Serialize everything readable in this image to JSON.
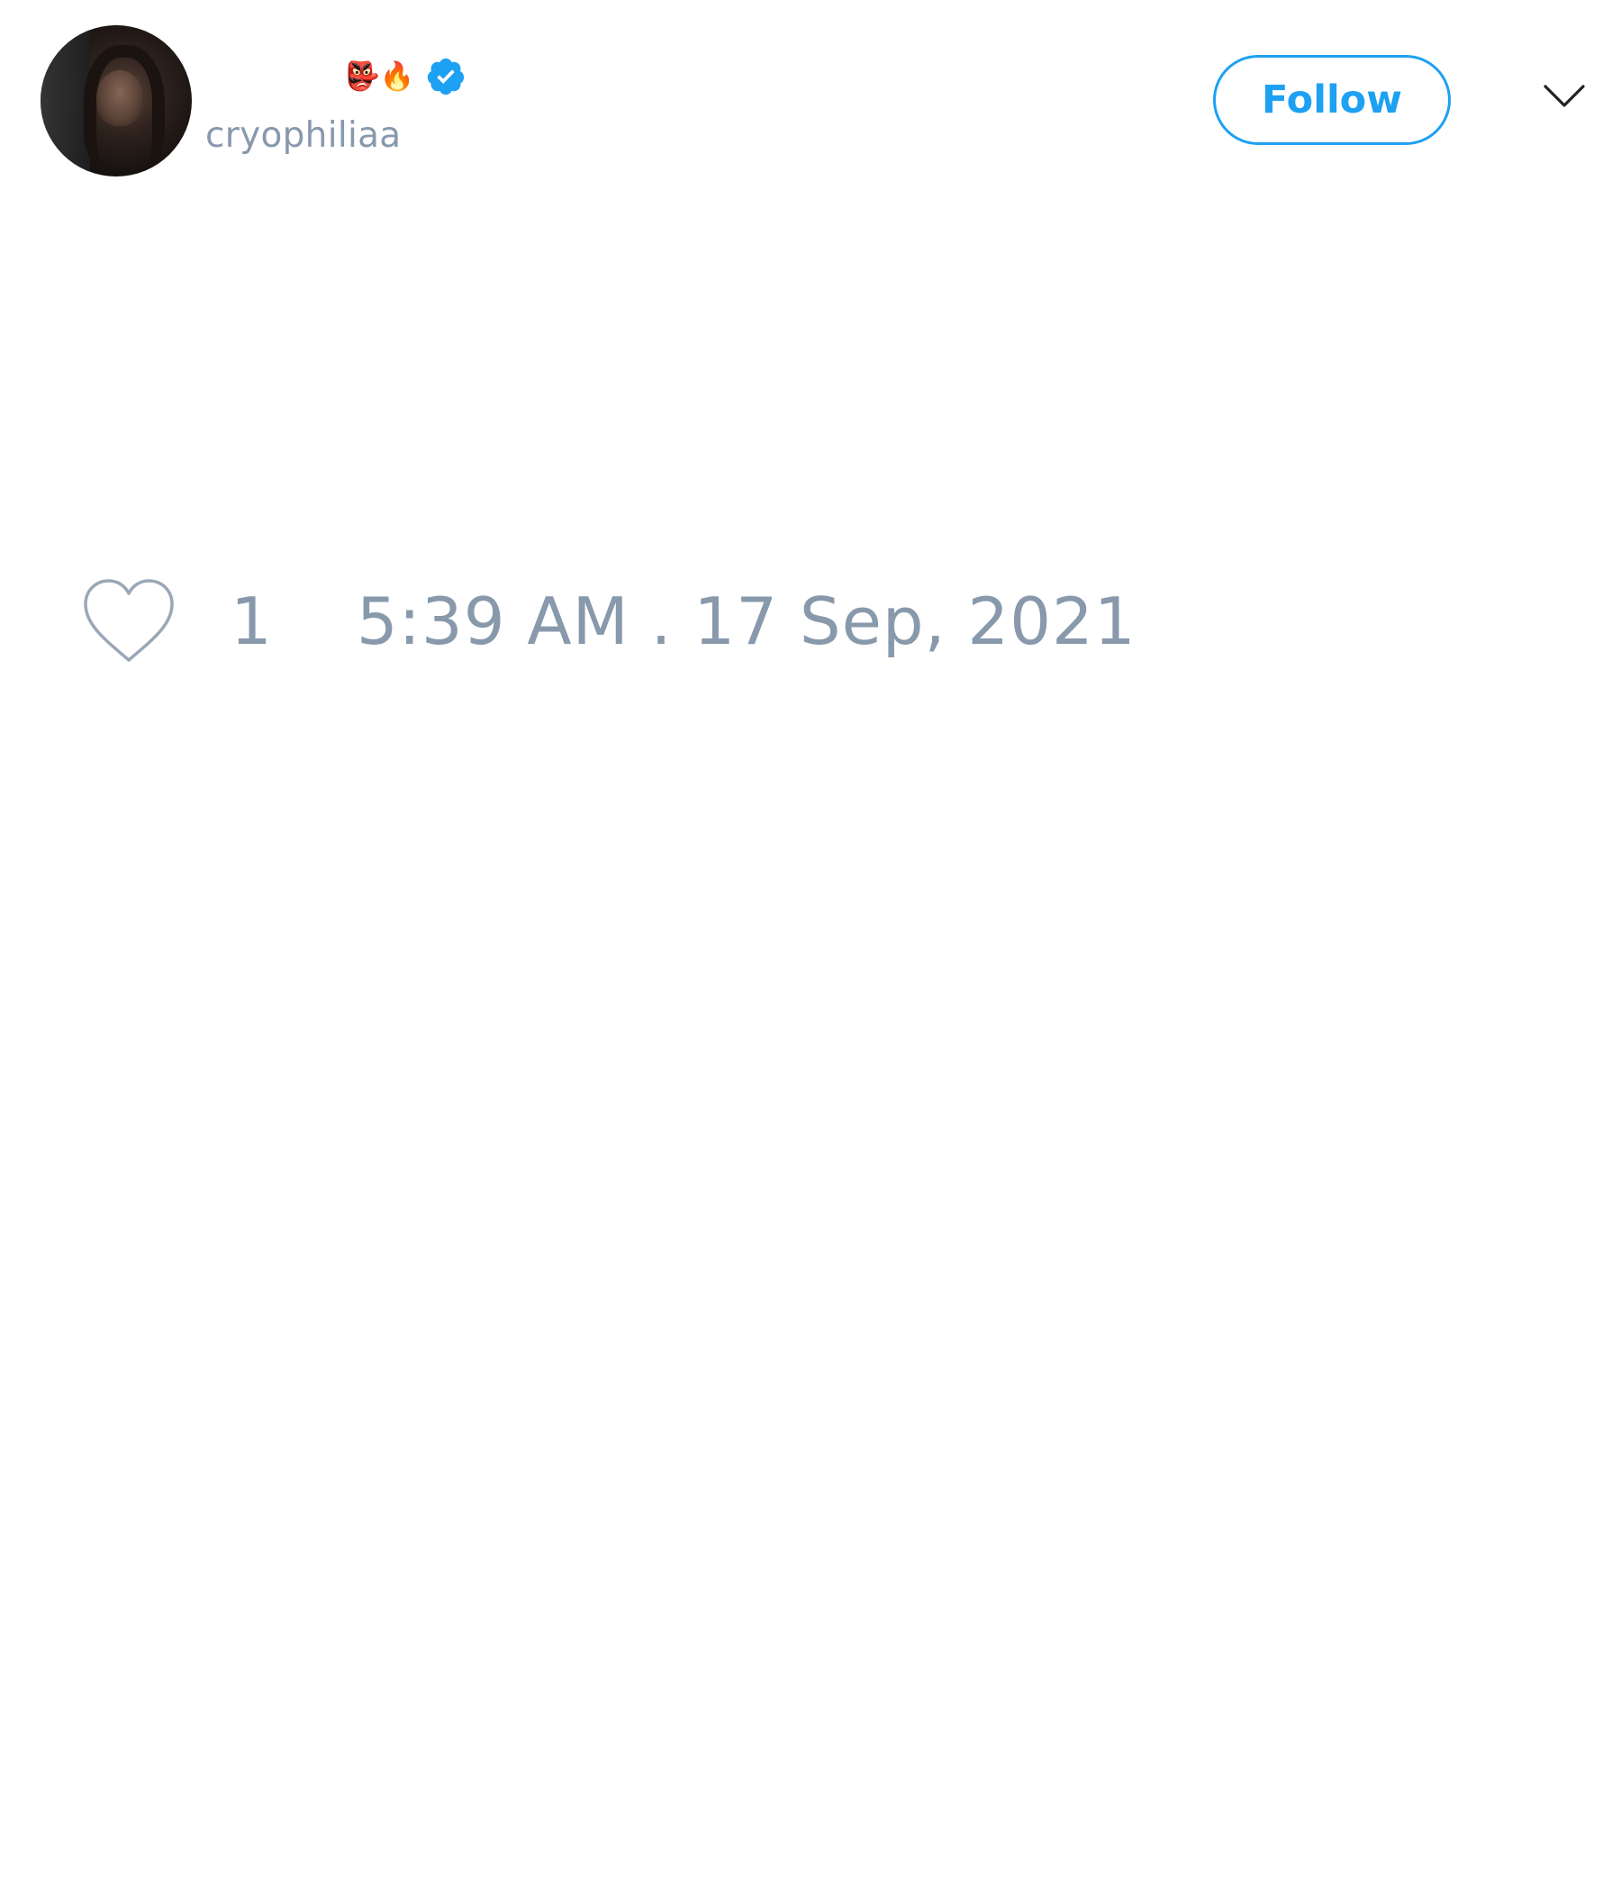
{
  "tweet": {
    "author": {
      "name_emojis": "👺🔥",
      "verified": true,
      "handle": "cryophiliaa"
    },
    "follow_label": "Follow",
    "like_count": "1",
    "timestamp": "5:39 AM . 17 Sep, 2021"
  },
  "colors": {
    "accent": "#1da1f2",
    "muted": "#8899ac",
    "background": "#ffffff"
  },
  "icons": {
    "avatar": "avatar",
    "verified": "verified-badge-icon",
    "menu": "chevron-down-icon",
    "like": "heart-icon"
  }
}
